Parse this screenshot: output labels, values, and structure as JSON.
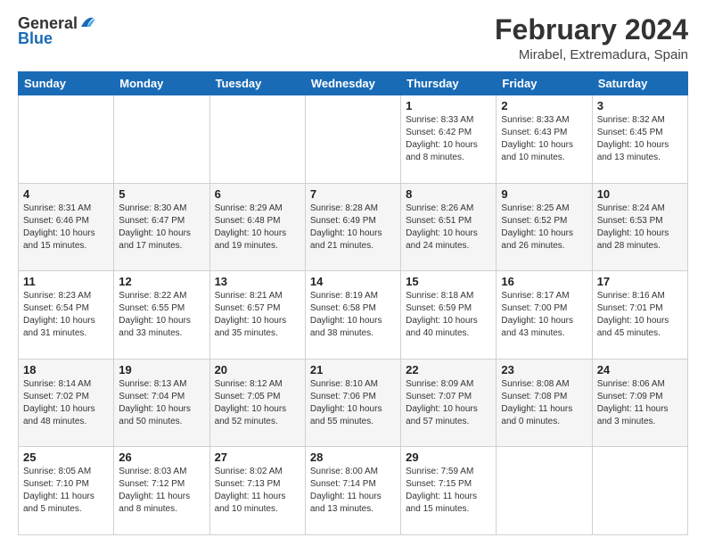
{
  "header": {
    "logo_general": "General",
    "logo_blue": "Blue",
    "month_year": "February 2024",
    "location": "Mirabel, Extremadura, Spain"
  },
  "weekdays": [
    "Sunday",
    "Monday",
    "Tuesday",
    "Wednesday",
    "Thursday",
    "Friday",
    "Saturday"
  ],
  "weeks": [
    [
      {
        "day": "",
        "info": ""
      },
      {
        "day": "",
        "info": ""
      },
      {
        "day": "",
        "info": ""
      },
      {
        "day": "",
        "info": ""
      },
      {
        "day": "1",
        "info": "Sunrise: 8:33 AM\nSunset: 6:42 PM\nDaylight: 10 hours\nand 8 minutes."
      },
      {
        "day": "2",
        "info": "Sunrise: 8:33 AM\nSunset: 6:43 PM\nDaylight: 10 hours\nand 10 minutes."
      },
      {
        "day": "3",
        "info": "Sunrise: 8:32 AM\nSunset: 6:45 PM\nDaylight: 10 hours\nand 13 minutes."
      }
    ],
    [
      {
        "day": "4",
        "info": "Sunrise: 8:31 AM\nSunset: 6:46 PM\nDaylight: 10 hours\nand 15 minutes."
      },
      {
        "day": "5",
        "info": "Sunrise: 8:30 AM\nSunset: 6:47 PM\nDaylight: 10 hours\nand 17 minutes."
      },
      {
        "day": "6",
        "info": "Sunrise: 8:29 AM\nSunset: 6:48 PM\nDaylight: 10 hours\nand 19 minutes."
      },
      {
        "day": "7",
        "info": "Sunrise: 8:28 AM\nSunset: 6:49 PM\nDaylight: 10 hours\nand 21 minutes."
      },
      {
        "day": "8",
        "info": "Sunrise: 8:26 AM\nSunset: 6:51 PM\nDaylight: 10 hours\nand 24 minutes."
      },
      {
        "day": "9",
        "info": "Sunrise: 8:25 AM\nSunset: 6:52 PM\nDaylight: 10 hours\nand 26 minutes."
      },
      {
        "day": "10",
        "info": "Sunrise: 8:24 AM\nSunset: 6:53 PM\nDaylight: 10 hours\nand 28 minutes."
      }
    ],
    [
      {
        "day": "11",
        "info": "Sunrise: 8:23 AM\nSunset: 6:54 PM\nDaylight: 10 hours\nand 31 minutes."
      },
      {
        "day": "12",
        "info": "Sunrise: 8:22 AM\nSunset: 6:55 PM\nDaylight: 10 hours\nand 33 minutes."
      },
      {
        "day": "13",
        "info": "Sunrise: 8:21 AM\nSunset: 6:57 PM\nDaylight: 10 hours\nand 35 minutes."
      },
      {
        "day": "14",
        "info": "Sunrise: 8:19 AM\nSunset: 6:58 PM\nDaylight: 10 hours\nand 38 minutes."
      },
      {
        "day": "15",
        "info": "Sunrise: 8:18 AM\nSunset: 6:59 PM\nDaylight: 10 hours\nand 40 minutes."
      },
      {
        "day": "16",
        "info": "Sunrise: 8:17 AM\nSunset: 7:00 PM\nDaylight: 10 hours\nand 43 minutes."
      },
      {
        "day": "17",
        "info": "Sunrise: 8:16 AM\nSunset: 7:01 PM\nDaylight: 10 hours\nand 45 minutes."
      }
    ],
    [
      {
        "day": "18",
        "info": "Sunrise: 8:14 AM\nSunset: 7:02 PM\nDaylight: 10 hours\nand 48 minutes."
      },
      {
        "day": "19",
        "info": "Sunrise: 8:13 AM\nSunset: 7:04 PM\nDaylight: 10 hours\nand 50 minutes."
      },
      {
        "day": "20",
        "info": "Sunrise: 8:12 AM\nSunset: 7:05 PM\nDaylight: 10 hours\nand 52 minutes."
      },
      {
        "day": "21",
        "info": "Sunrise: 8:10 AM\nSunset: 7:06 PM\nDaylight: 10 hours\nand 55 minutes."
      },
      {
        "day": "22",
        "info": "Sunrise: 8:09 AM\nSunset: 7:07 PM\nDaylight: 10 hours\nand 57 minutes."
      },
      {
        "day": "23",
        "info": "Sunrise: 8:08 AM\nSunset: 7:08 PM\nDaylight: 11 hours\nand 0 minutes."
      },
      {
        "day": "24",
        "info": "Sunrise: 8:06 AM\nSunset: 7:09 PM\nDaylight: 11 hours\nand 3 minutes."
      }
    ],
    [
      {
        "day": "25",
        "info": "Sunrise: 8:05 AM\nSunset: 7:10 PM\nDaylight: 11 hours\nand 5 minutes."
      },
      {
        "day": "26",
        "info": "Sunrise: 8:03 AM\nSunset: 7:12 PM\nDaylight: 11 hours\nand 8 minutes."
      },
      {
        "day": "27",
        "info": "Sunrise: 8:02 AM\nSunset: 7:13 PM\nDaylight: 11 hours\nand 10 minutes."
      },
      {
        "day": "28",
        "info": "Sunrise: 8:00 AM\nSunset: 7:14 PM\nDaylight: 11 hours\nand 13 minutes."
      },
      {
        "day": "29",
        "info": "Sunrise: 7:59 AM\nSunset: 7:15 PM\nDaylight: 11 hours\nand 15 minutes."
      },
      {
        "day": "",
        "info": ""
      },
      {
        "day": "",
        "info": ""
      }
    ]
  ]
}
